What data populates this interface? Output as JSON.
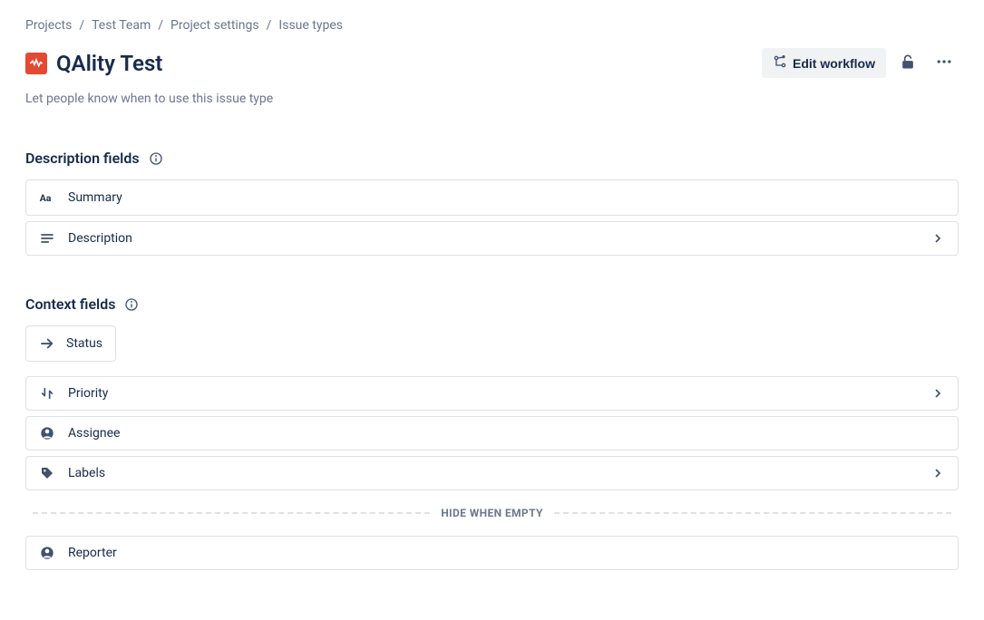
{
  "breadcrumb": [
    {
      "label": "Projects"
    },
    {
      "label": "Test Team"
    },
    {
      "label": "Project settings"
    },
    {
      "label": "Issue types"
    }
  ],
  "pageTitle": "QAlity Test",
  "subtitle": "Let people know when to use this issue type",
  "actions": {
    "editWorkflow": "Edit workflow"
  },
  "sections": {
    "description": {
      "title": "Description fields",
      "fields": {
        "summary": "Summary",
        "description": "Description"
      }
    },
    "context": {
      "title": "Context fields",
      "status": "Status",
      "fields": {
        "priority": "Priority",
        "assignee": "Assignee",
        "labels": "Labels"
      },
      "divider": "HIDE WHEN EMPTY",
      "hiddenFields": {
        "reporter": "Reporter"
      }
    }
  }
}
